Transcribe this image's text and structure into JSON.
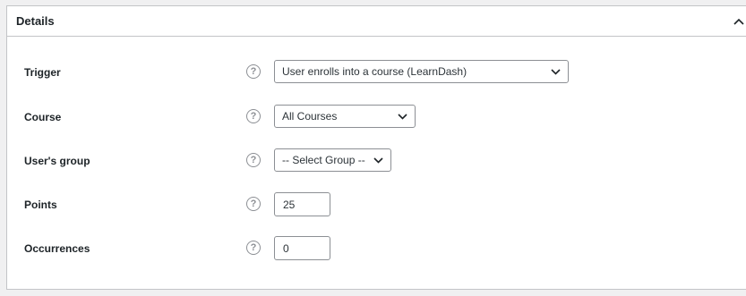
{
  "panel": {
    "title": "Details",
    "toggle_icon": "chevron-up-icon"
  },
  "fields": {
    "trigger": {
      "label": "Trigger",
      "value": "User enrolls into a course (LearnDash)",
      "help_icon": "help-icon"
    },
    "course": {
      "label": "Course",
      "value": "All Courses",
      "help_icon": "help-icon"
    },
    "group": {
      "label": "User's group",
      "value": "-- Select Group --",
      "help_icon": "help-icon"
    },
    "points": {
      "label": "Points",
      "value": "25",
      "help_icon": "help-icon"
    },
    "occurrences": {
      "label": "Occurrences",
      "value": "0",
      "help_icon": "help-icon"
    }
  },
  "help_glyph": "?",
  "colors": {
    "background": "#f0f0f1",
    "panel": "#ffffff",
    "border": "#c3c4c7",
    "field_border": "#8c8f94",
    "text": "#1d2327"
  }
}
